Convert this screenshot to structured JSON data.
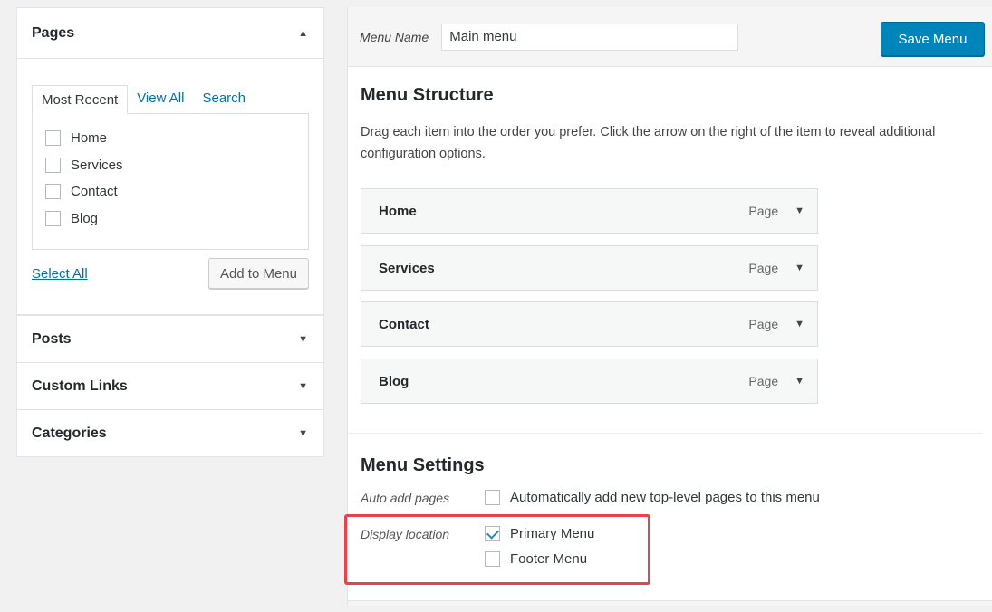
{
  "left": {
    "pages": {
      "title": "Pages",
      "tabs": [
        "Most Recent",
        "View All",
        "Search"
      ],
      "items": [
        "Home",
        "Services",
        "Contact",
        "Blog"
      ],
      "select_all": "Select All",
      "add_to_menu": "Add to Menu"
    },
    "collapsed": [
      "Posts",
      "Custom Links",
      "Categories"
    ]
  },
  "right": {
    "menu_name_label": "Menu Name",
    "menu_name_value": "Main menu",
    "save_menu": "Save Menu",
    "structure_title": "Menu Structure",
    "structure_desc": "Drag each item into the order you prefer. Click the arrow on the right of the item to reveal additional configuration options.",
    "menu_items": [
      {
        "title": "Home",
        "type": "Page"
      },
      {
        "title": "Services",
        "type": "Page"
      },
      {
        "title": "Contact",
        "type": "Page"
      },
      {
        "title": "Blog",
        "type": "Page"
      }
    ],
    "settings_title": "Menu Settings",
    "auto_add_label": "Auto add pages",
    "auto_add_text": "Automatically add new top-level pages to this menu",
    "display_location_label": "Display location",
    "locations": [
      {
        "name": "Primary Menu",
        "checked": true
      },
      {
        "name": "Footer Menu",
        "checked": false
      }
    ]
  },
  "colors": {
    "accent": "#0085ba",
    "link": "#0073aa",
    "highlight": "#e8434a"
  }
}
